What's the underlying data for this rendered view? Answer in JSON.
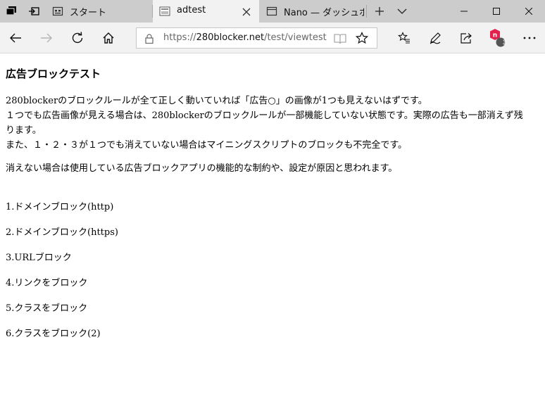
{
  "tabs": [
    {
      "title": "スタート",
      "icon": "new-tab-page-icon",
      "active": false
    },
    {
      "title": "adtest",
      "icon": "page-thumbnail-icon",
      "active": true
    },
    {
      "title": "Nano — ダッシュボー",
      "icon": "page-icon",
      "active": false
    }
  ],
  "address": {
    "scheme": "https://",
    "host": "280blocker.net",
    "path": "/test/viewtest.html"
  },
  "extension": {
    "badge": "3",
    "color": "#e2224c"
  },
  "content": {
    "title": "広告ブロックテスト",
    "paragraph1": [
      "280blockerのブロックルールが全て正しく動いていれば「広告○」の画像が1つも見えないはずです。",
      "１つでも広告画像が見える場合は、280blockerのブロックルールが一部機能していない状態です。実際の広告も一部消えず残",
      "ります。",
      "また、１・２・３が１つでも消えていない場合はマイニングスクリプトのブロックも不完全です。"
    ],
    "paragraph2": "消えない場合は使用している広告ブロックアプリの機能的な制約や、設定が原因と思われます。",
    "items": [
      "1.ドメインブロック(http)",
      "2.ドメインブロック(https)",
      "3.URLブロック",
      "4.リンクをブロック",
      "5.クラスをブロック",
      "6.クラスをブロック(2)"
    ]
  }
}
